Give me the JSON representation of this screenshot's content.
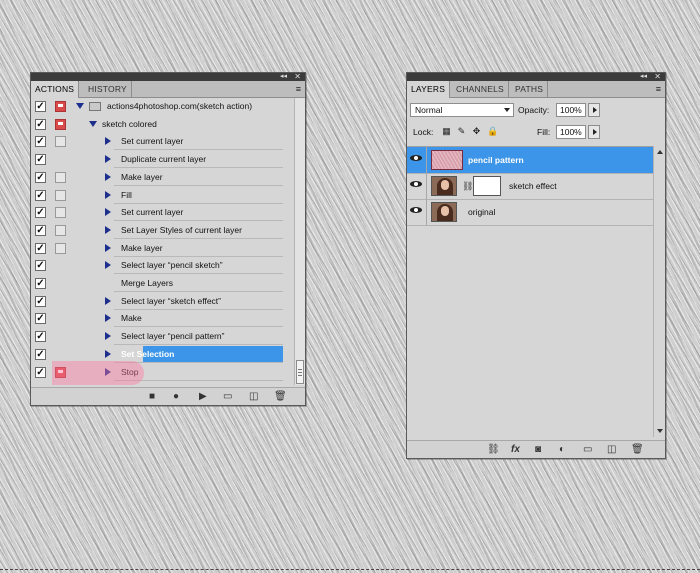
{
  "actions_panel": {
    "tabs": [
      {
        "label": "ACTIONS",
        "active": true
      },
      {
        "label": "HISTORY",
        "active": false
      }
    ],
    "collapse_glyph": "◂◂",
    "close_glyph": "✕",
    "menu_glyph": "≡",
    "rows": [
      {
        "kind": "set",
        "label": "actions4photoshop.com(sketch action)",
        "checked": true,
        "dialog": "on"
      },
      {
        "kind": "action",
        "label": "sketch colored",
        "checked": true,
        "dialog": "on"
      },
      {
        "kind": "step",
        "label": "Set current layer",
        "checked": true,
        "dialog": "off"
      },
      {
        "kind": "step",
        "label": "Duplicate current layer",
        "checked": true,
        "dialog": "none"
      },
      {
        "kind": "step",
        "label": "Make layer",
        "checked": true,
        "dialog": "off"
      },
      {
        "kind": "step",
        "label": "Fill",
        "checked": true,
        "dialog": "off"
      },
      {
        "kind": "step",
        "label": "Set current layer",
        "checked": true,
        "dialog": "off"
      },
      {
        "kind": "step",
        "label": "Set Layer Styles of current layer",
        "checked": true,
        "dialog": "off"
      },
      {
        "kind": "step",
        "label": "Make layer",
        "checked": true,
        "dialog": "off"
      },
      {
        "kind": "step",
        "label": "Select layer “pencil sketch”",
        "checked": true,
        "dialog": "none"
      },
      {
        "kind": "plain",
        "label": "Merge Layers",
        "checked": true,
        "dialog": "none"
      },
      {
        "kind": "step",
        "label": "Select layer “sketch effect”",
        "checked": true,
        "dialog": "none"
      },
      {
        "kind": "step",
        "label": "Make",
        "checked": true,
        "dialog": "none"
      },
      {
        "kind": "step",
        "label": "Select layer “pencil pattern”",
        "checked": true,
        "dialog": "none"
      },
      {
        "kind": "step",
        "label": "Set Selection",
        "checked": true,
        "dialog": "none",
        "selected": true
      },
      {
        "kind": "step",
        "label": "Stop",
        "checked": true,
        "dialog": "on"
      }
    ],
    "bottom_icons": [
      "stop-icon",
      "record-icon",
      "play-icon",
      "new-set-icon",
      "new-action-icon",
      "delete-icon"
    ]
  },
  "layers_panel": {
    "tabs": [
      {
        "label": "LAYERS",
        "active": true
      },
      {
        "label": "CHANNELS",
        "active": false
      },
      {
        "label": "PATHS",
        "active": false
      }
    ],
    "collapse_glyph": "◂◂",
    "close_glyph": "✕",
    "menu_glyph": "≡",
    "blend_mode": "Normal",
    "opacity_label": "Opacity:",
    "opacity_value": "100%",
    "lock_label": "Lock:",
    "fill_label": "Fill:",
    "fill_value": "100%",
    "layers": [
      {
        "name": "pencil pattern",
        "selected": true,
        "thumb": "pattern"
      },
      {
        "name": "sketch effect",
        "selected": false,
        "thumb": "photo",
        "mask": true
      },
      {
        "name": "original",
        "selected": false,
        "thumb": "photo"
      }
    ],
    "bottom_icons": [
      "link-icon",
      "fx-icon",
      "mask-icon",
      "adjustment-icon",
      "group-icon",
      "new-layer-icon",
      "delete-icon"
    ]
  },
  "accent_color": "#3c95e8"
}
